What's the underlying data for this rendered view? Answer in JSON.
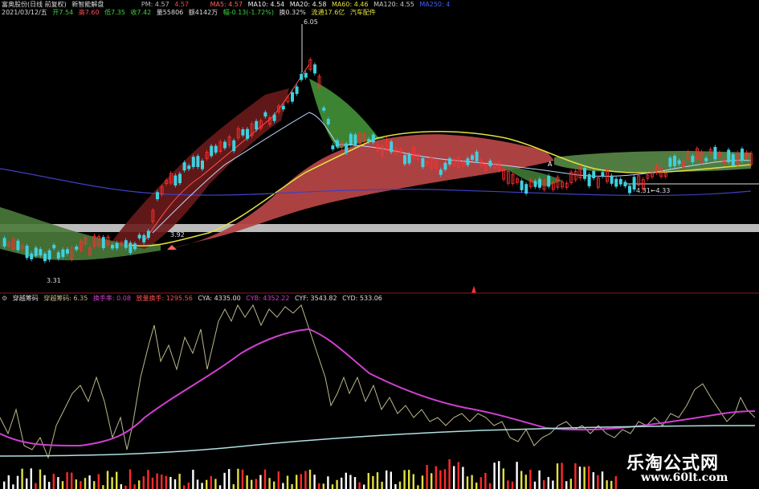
{
  "header1": {
    "stock_title": "富奥股份(日线 前复权)",
    "indicator_name": "新智能解盘",
    "pm_label": "PM: 4.57",
    "pm_value": "4.57",
    "ma5": "MA5: 4.57",
    "ma10": "MA10: 4.54",
    "ma20": "MA20: 4.58",
    "ma60": "MA60: 4.46",
    "ma120": "MA120: 4.55",
    "extra": "MA250: 4"
  },
  "header2": {
    "date": "2021/03/12/五",
    "open": "开7.54",
    "high": "高7.60",
    "low": "低7.35",
    "close": "收7.42",
    "volume": "量55806",
    "amount": "额4142万",
    "change": "幅-0.13(-1.72%)",
    "turnover": "换0.32%",
    "float_cap": "流通17.6亿",
    "sector": "汽车配件"
  },
  "annotations": {
    "peak": "6.05",
    "low1": "3.92",
    "low2": "3.31",
    "range": "4.31←4.33",
    "marker_a": "A"
  },
  "sub_header": {
    "name": "穿越筹码",
    "line1": "穿越筹码: 6.35",
    "line2": "换手率: 0.08",
    "line3": "放量换手: 1295.56",
    "cya": "CYA: 4335.00",
    "cyb": "CYB: 4352.22",
    "cyf": "CYF: 3543.82",
    "cyd": "CYD: 533.06"
  },
  "watermark": {
    "cn": "乐淘公式网",
    "url": "www.60lt.com"
  },
  "colors": {
    "up": "#ff3030",
    "down": "#40d0e0",
    "green_cloud": "#4a8a3a",
    "red_cloud": "#a03a3a",
    "yellow": "#e0e040",
    "magenta": "#d040d0",
    "khaki": "#bdb78a",
    "cyan_line": "#b0e0e0"
  }
}
